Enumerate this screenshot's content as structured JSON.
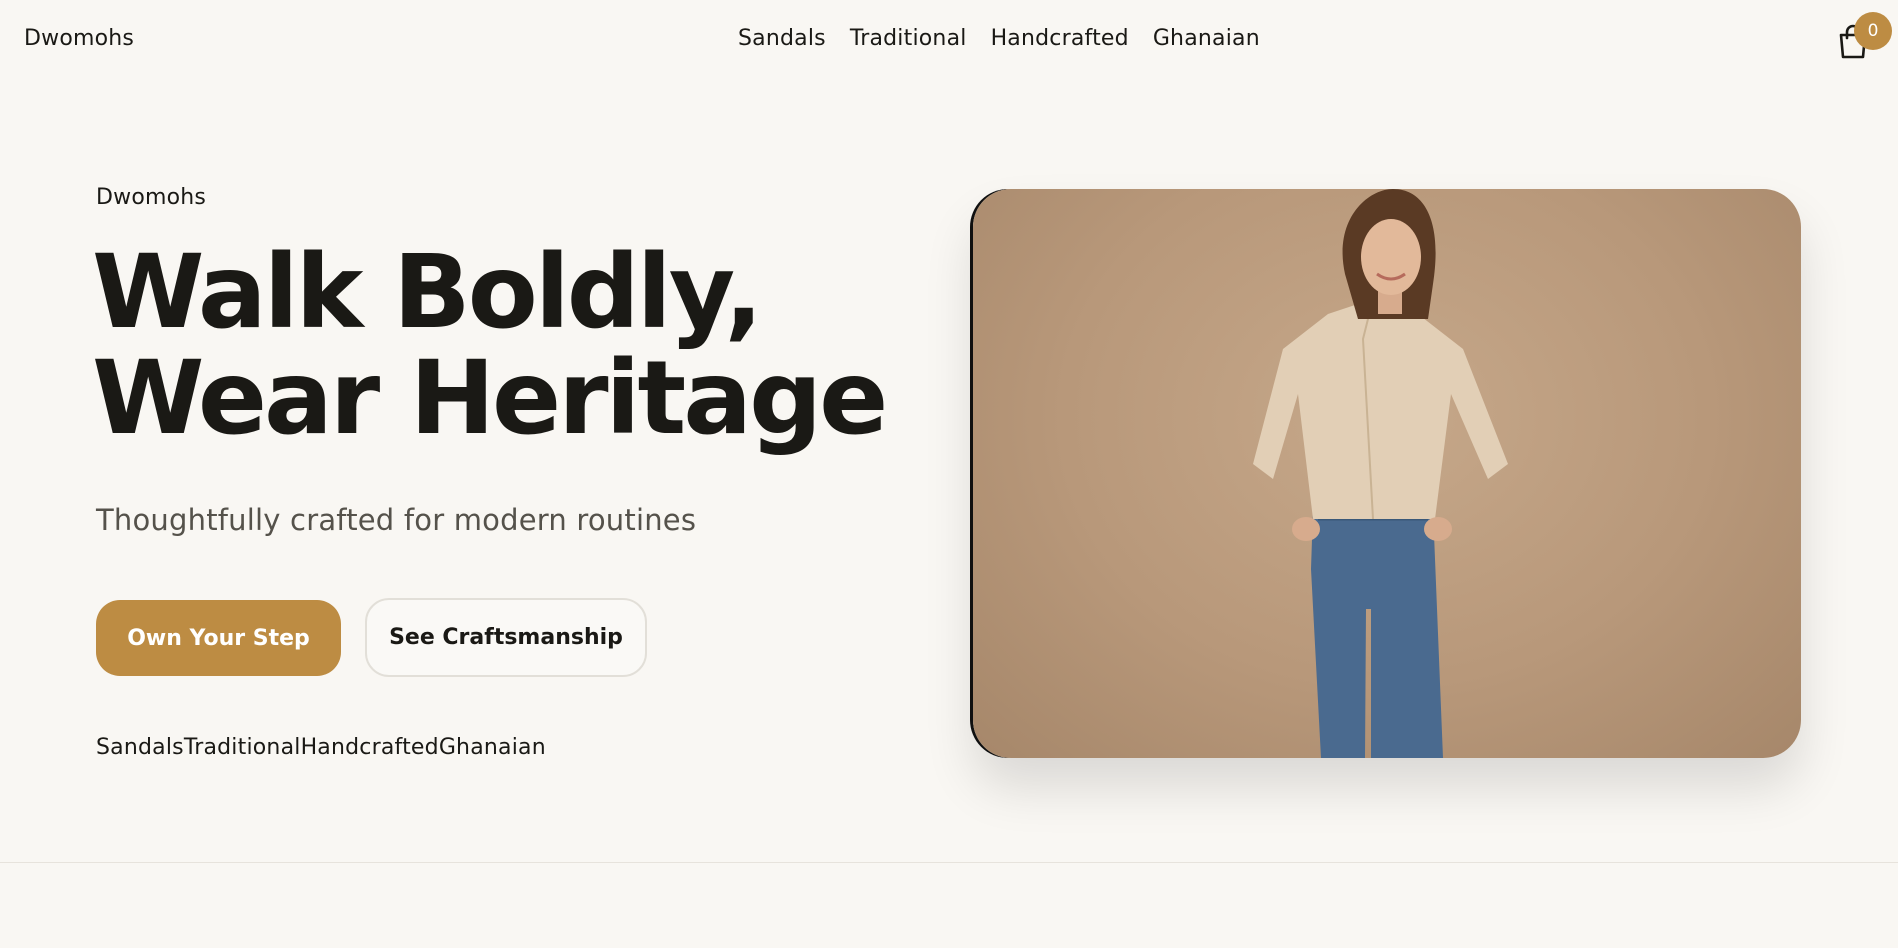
{
  "nav": {
    "brand": "Dwomohs",
    "links": [
      "Sandals",
      "Traditional",
      "Handcrafted",
      "Ghanaian"
    ],
    "cart_count": "0",
    "cart_icon": "shopping-bag-icon"
  },
  "hero": {
    "eyebrow": "Dwomohs",
    "headline_line1": "Walk Boldly,",
    "headline_line2": "Wear Heritage",
    "subtitle": "Thoughtfully crafted for modern routines",
    "primary_cta": "Own Your Step",
    "secondary_cta": "See Craftsmanship",
    "tags": [
      "Sandals",
      "Traditional",
      "Handcrafted",
      "Ghanaian"
    ]
  },
  "colors": {
    "background": "#f9f7f3",
    "accent": "#bd8c43",
    "text": "#1a1915",
    "muted_text": "#55524b",
    "image_backdrop": "#b8987a"
  }
}
